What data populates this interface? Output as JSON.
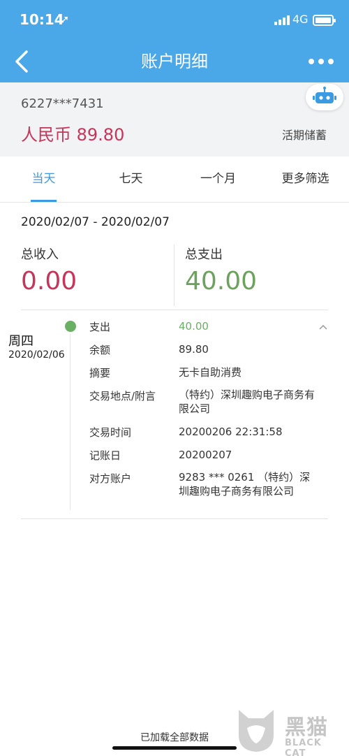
{
  "status_bar": {
    "time": "10:14",
    "location_icon": "location-arrow-icon",
    "network": "4G"
  },
  "nav": {
    "title": "账户明细",
    "back_icon": "chevron-left-icon",
    "more_icon": "more-dots-icon"
  },
  "account": {
    "number": "6227***7431",
    "balance": "人民币 89.80",
    "type": "活期储蓄",
    "assistant_icon": "robot-icon"
  },
  "tabs": [
    {
      "label": "当天",
      "active": true
    },
    {
      "label": "七天",
      "active": false
    },
    {
      "label": "一个月",
      "active": false
    },
    {
      "label": "更多筛选",
      "active": false
    }
  ],
  "summary": {
    "range": "2020/02/07 - 2020/02/07",
    "income_label": "总收入",
    "income_value": "0.00",
    "expense_label": "总支出",
    "expense_value": "40.00"
  },
  "transaction": {
    "weekday": "周四",
    "date": "2020/02/06",
    "rows": [
      {
        "key": "支出",
        "value": "40.00"
      },
      {
        "key": "余额",
        "value": "89.80"
      },
      {
        "key": "摘要",
        "value": "无卡自助消费"
      },
      {
        "key": "交易地点/附言",
        "value": "（特约）深圳趣购电子商务有限公司"
      },
      {
        "key": "交易时间",
        "value": "20200206 22:31:58"
      },
      {
        "key": "记账日",
        "value": "20200207"
      },
      {
        "key": "对方账户",
        "value": "9283 *** 0261 （特约）深圳趣购电子商务有限公司"
      }
    ]
  },
  "footer": {
    "loaded_text": "已加载全部数据"
  },
  "watermark": {
    "brand": "黑猫",
    "sub": "BLACK CAT"
  },
  "colors": {
    "header_blue": "#4aa7e8",
    "income_red": "#c4365a",
    "expense_green": "#6ca35c",
    "tab_active": "#3a9be2"
  }
}
